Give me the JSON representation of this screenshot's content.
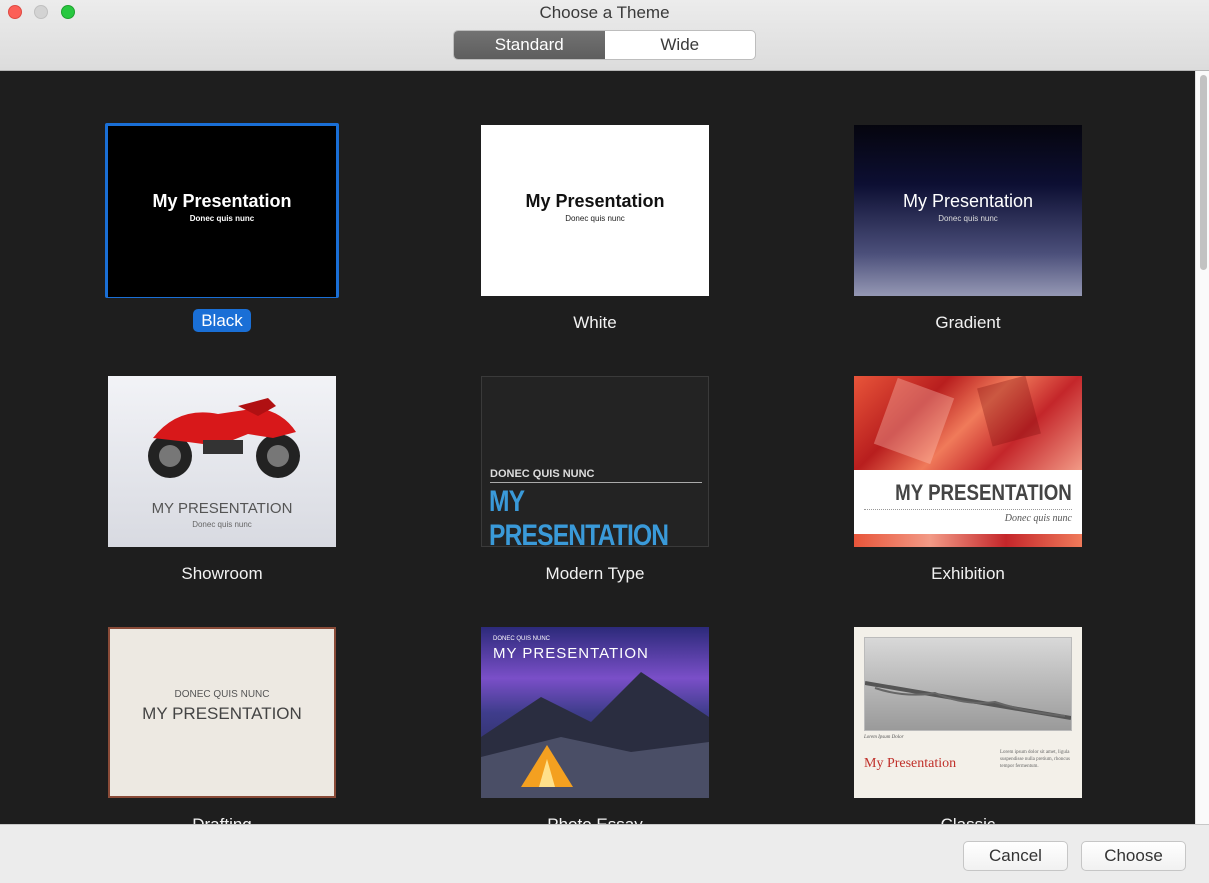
{
  "window": {
    "title": "Choose a Theme"
  },
  "segmented": {
    "items": [
      "Standard",
      "Wide"
    ],
    "selected": "Standard"
  },
  "sample": {
    "title": "My Presentation",
    "subtitle": "Donec quis nunc",
    "title_caps": "MY PRESENTATION",
    "subtitle_caps": "DONEC QUIS NUNC",
    "lorem_label": "Lorem Ipsum Dolor",
    "lorem_body": "Lorem ipsum dolor sit amet, ligula suspendisse nulla pretium, rhoncus tempor fermentum."
  },
  "themes": [
    {
      "name": "Black",
      "selected": true
    },
    {
      "name": "White",
      "selected": false
    },
    {
      "name": "Gradient",
      "selected": false
    },
    {
      "name": "Showroom",
      "selected": false
    },
    {
      "name": "Modern Type",
      "selected": false
    },
    {
      "name": "Exhibition",
      "selected": false
    },
    {
      "name": "Drafting",
      "selected": false
    },
    {
      "name": "Photo Essay",
      "selected": false
    },
    {
      "name": "Classic",
      "selected": false
    }
  ],
  "buttons": {
    "cancel": "Cancel",
    "choose": "Choose"
  },
  "colors": {
    "accent": "#1a6fd6",
    "modern_blue": "#3a9ad9",
    "classic_red": "#c0302a"
  }
}
